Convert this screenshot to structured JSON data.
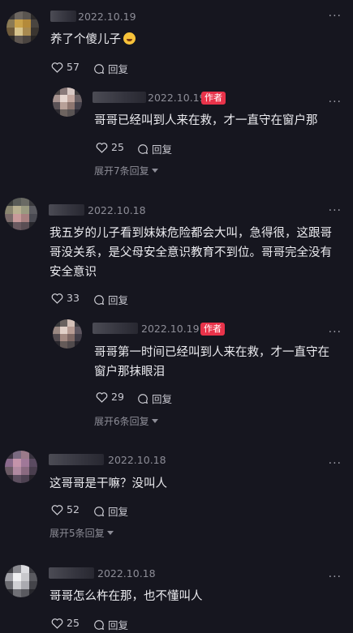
{
  "colors": {
    "background": "#16161f",
    "author_badge": "#e8334a"
  },
  "labels": {
    "reply": "回复",
    "author": "作者"
  },
  "comments": [
    {
      "date": "2022.10.19",
      "text": "养了个傻儿子",
      "likes": "57",
      "reply": {
        "date": "2022.10.19",
        "text": "哥哥已经叫到人来在救，才一直守在窗户那",
        "likes": "25"
      },
      "expand": "展开7条回复"
    },
    {
      "date": "2022.10.18",
      "text": "我五岁的儿子看到妹妹危险都会大叫，急得很，这跟哥哥没关系，是父母安全意识教育不到位。哥哥完全没有安全意识",
      "likes": "33",
      "reply": {
        "date": "2022.10.19",
        "text": "哥哥第一时间已经叫到人来在救，才一直守在窗户那抹眼泪",
        "likes": "29"
      },
      "expand": "展开6条回复"
    },
    {
      "date": "2022.10.18",
      "text": "这哥哥是干嘛？没叫人",
      "likes": "52",
      "expand": "展开5条回复"
    },
    {
      "date": "2022.10.18",
      "text": "哥哥怎么杵在那，也不懂叫人",
      "likes": "25"
    }
  ]
}
